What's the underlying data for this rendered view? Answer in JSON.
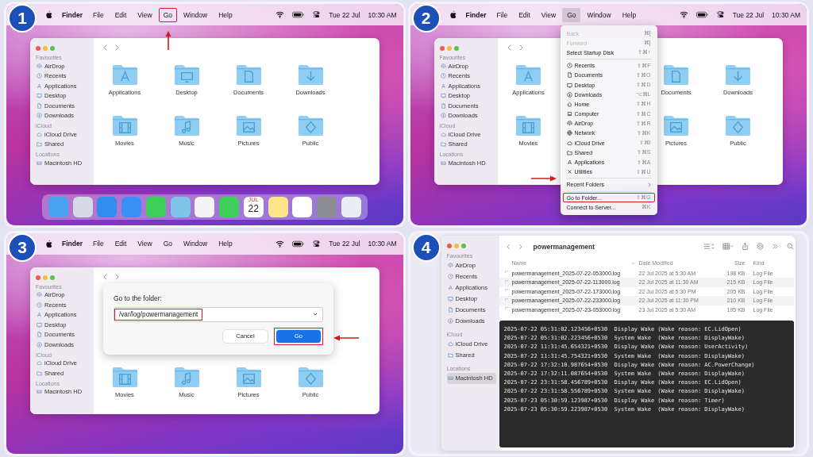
{
  "steps": [
    {
      "number": "1",
      "kind": "menu_bar",
      "pointer": {
        "kind": "up"
      },
      "menubar": {
        "app": "Finder",
        "menus": [
          {
            "label": "File",
            "selected": false,
            "highlighted": false
          },
          {
            "label": "Edit",
            "selected": false,
            "highlighted": false
          },
          {
            "label": "View",
            "selected": false,
            "highlighted": false
          },
          {
            "label": "Go",
            "selected": false,
            "highlighted": true
          },
          {
            "label": "Window",
            "selected": false,
            "highlighted": false
          },
          {
            "label": "Help",
            "selected": false,
            "highlighted": false
          }
        ],
        "date": "Tue 22 Jul",
        "time": "10:30 AM"
      },
      "finder": {
        "sidebar": [
          {
            "heading": "Favourites",
            "items": [
              {
                "label": "AirDrop",
                "selected": false
              },
              {
                "label": "Recents",
                "selected": false
              },
              {
                "label": "Applications",
                "selected": false
              },
              {
                "label": "Desktop",
                "selected": false
              },
              {
                "label": "Documents",
                "selected": false
              },
              {
                "label": "Downloads",
                "selected": false
              }
            ]
          },
          {
            "heading": "iCloud",
            "items": [
              {
                "label": "iCloud Drive",
                "selected": false
              },
              {
                "label": "Shared",
                "selected": false
              }
            ]
          },
          {
            "heading": "Locations",
            "items": [
              {
                "label": "Macintosh HD",
                "selected": false
              }
            ]
          }
        ],
        "folders": [
          {
            "label": "Applications"
          },
          {
            "label": "Desktop"
          },
          {
            "label": "Documents"
          },
          {
            "label": "Downloads"
          },
          {
            "label": "Movies"
          },
          {
            "label": "Music"
          },
          {
            "label": "Pictures"
          },
          {
            "label": "Public"
          }
        ]
      },
      "dock": {
        "calendar_month": "JUL",
        "calendar_day": "22"
      }
    },
    {
      "number": "2",
      "kind": "go_menu",
      "pointer": {
        "kind": "right"
      },
      "menubar": {
        "app": "Finder",
        "menus": [
          {
            "label": "File",
            "selected": false,
            "highlighted": false
          },
          {
            "label": "Edit",
            "selected": false,
            "highlighted": false
          },
          {
            "label": "View",
            "selected": false,
            "highlighted": false
          },
          {
            "label": "Go",
            "selected": true,
            "highlighted": false
          },
          {
            "label": "Window",
            "selected": false,
            "highlighted": false
          },
          {
            "label": "Help",
            "selected": false,
            "highlighted": false
          }
        ],
        "date": "Tue 22 Jul",
        "time": "10:30 AM"
      },
      "finder": {
        "sidebar": [
          {
            "heading": "Favourites",
            "items": [
              {
                "label": "AirDrop",
                "selected": false
              },
              {
                "label": "Recents",
                "selected": false
              },
              {
                "label": "Applications",
                "selected": false
              },
              {
                "label": "Desktop",
                "selected": false
              },
              {
                "label": "Documents",
                "selected": false
              },
              {
                "label": "Downloads",
                "selected": false
              }
            ]
          },
          {
            "heading": "iCloud",
            "items": [
              {
                "label": "iCloud Drive",
                "selected": false
              },
              {
                "label": "Shared",
                "selected": false
              }
            ]
          },
          {
            "heading": "Locations",
            "items": [
              {
                "label": "Macintosh HD",
                "selected": false
              }
            ]
          }
        ],
        "folders": [
          {
            "label": "Applications"
          },
          {
            "label": "Documents"
          },
          {
            "label": "Downloads"
          },
          {
            "label": "Movies"
          },
          {
            "label": "Pictures"
          },
          {
            "label": "Public"
          }
        ]
      },
      "menu": {
        "items": [
          {
            "kind": "item",
            "label": "Back",
            "shortcut": "⌘[",
            "disabled": true,
            "highlighted": false
          },
          {
            "kind": "item",
            "label": "Forward",
            "shortcut": "⌘]",
            "disabled": true,
            "highlighted": false
          },
          {
            "kind": "item",
            "label": "Select Startup Disk",
            "shortcut": "⇧⌘↑",
            "disabled": false,
            "highlighted": false
          },
          {
            "kind": "separator"
          },
          {
            "kind": "place",
            "label": "Recents",
            "shortcut": "⇧⌘F",
            "disabled": false,
            "highlighted": false
          },
          {
            "kind": "place",
            "label": "Documents",
            "shortcut": "⇧⌘O",
            "disabled": false,
            "highlighted": false
          },
          {
            "kind": "place",
            "label": "Desktop",
            "shortcut": "⇧⌘D",
            "disabled": false,
            "highlighted": false
          },
          {
            "kind": "place",
            "label": "Downloads",
            "shortcut": "⌥⌘L",
            "disabled": false,
            "highlighted": false
          },
          {
            "kind": "place",
            "label": "Home",
            "shortcut": "⇧⌘H",
            "disabled": false,
            "highlighted": false
          },
          {
            "kind": "place",
            "label": "Computer",
            "shortcut": "⇧⌘C",
            "disabled": false,
            "highlighted": false
          },
          {
            "kind": "place",
            "label": "AirDrop",
            "shortcut": "⇧⌘R",
            "disabled": false,
            "highlighted": false
          },
          {
            "kind": "place",
            "label": "Network",
            "shortcut": "⇧⌘K",
            "disabled": false,
            "highlighted": false
          },
          {
            "kind": "place",
            "label": "iCloud Drive",
            "shortcut": "⇧⌘I",
            "disabled": false,
            "highlighted": false
          },
          {
            "kind": "place",
            "label": "Shared",
            "shortcut": "⇧⌘S",
            "disabled": false,
            "highlighted": false
          },
          {
            "kind": "place",
            "label": "Applications",
            "shortcut": "⇧⌘A",
            "disabled": false,
            "highlighted": false
          },
          {
            "kind": "place",
            "label": "Utilities",
            "shortcut": "⇧⌘U",
            "disabled": false,
            "highlighted": false
          },
          {
            "kind": "separator"
          },
          {
            "kind": "submenu",
            "label": "Recent Folders",
            "disabled": false,
            "highlighted": false
          },
          {
            "kind": "separator"
          },
          {
            "kind": "item",
            "label": "Go to Folder...",
            "shortcut": "⇧⌘G",
            "disabled": false,
            "highlighted": true
          },
          {
            "kind": "item",
            "label": "Connect to Server...",
            "shortcut": "⌘K",
            "disabled": false,
            "highlighted": false
          }
        ]
      }
    },
    {
      "number": "3",
      "kind": "dialog",
      "pointer": {
        "kind": "left"
      },
      "menubar": {
        "app": "Finder",
        "menus": [
          {
            "label": "File",
            "selected": false,
            "highlighted": false
          },
          {
            "label": "Edit",
            "selected": false,
            "highlighted": false
          },
          {
            "label": "View",
            "selected": false,
            "highlighted": false
          },
          {
            "label": "Go",
            "selected": false,
            "highlighted": false
          },
          {
            "label": "Window",
            "selected": false,
            "highlighted": false
          },
          {
            "label": "Help",
            "selected": false,
            "highlighted": false
          }
        ],
        "date": "Tue 22 Jul",
        "time": "10:30 AM"
      },
      "finder": {
        "sidebar": [
          {
            "heading": "Favourites",
            "items": [
              {
                "label": "AirDrop",
                "selected": false
              },
              {
                "label": "Recents",
                "selected": false
              },
              {
                "label": "Applications",
                "selected": false
              },
              {
                "label": "Desktop",
                "selected": false
              },
              {
                "label": "Documents",
                "selected": false
              },
              {
                "label": "Downloads",
                "selected": false
              }
            ]
          },
          {
            "heading": "iCloud",
            "items": [
              {
                "label": "iCloud Drive",
                "selected": false
              },
              {
                "label": "Shared",
                "selected": false
              }
            ]
          },
          {
            "heading": "Locations",
            "items": [
              {
                "label": "Macintosh HD",
                "selected": false
              }
            ]
          }
        ],
        "folders": [
          {
            "label": "Movies"
          },
          {
            "label": "Music"
          },
          {
            "label": "Pictures"
          },
          {
            "label": "Public"
          }
        ]
      },
      "dialog": {
        "title": "Go to the folder:",
        "path": {
          "value": "/var/log/powermanagement",
          "highlighted": true
        },
        "buttons": [
          {
            "label": "Cancel",
            "default": false,
            "highlighted": false
          },
          {
            "label": "Go",
            "default": true,
            "highlighted": true
          }
        ]
      }
    },
    {
      "number": "4",
      "kind": "log_view",
      "finder": {
        "title": "powermanagement",
        "sidebar": [
          {
            "heading": "Favourites",
            "items": [
              {
                "label": "AirDrop",
                "selected": false
              },
              {
                "label": "Recents",
                "selected": false
              },
              {
                "label": "Applications",
                "selected": false
              },
              {
                "label": "Desktop",
                "selected": false
              },
              {
                "label": "Documents",
                "selected": false
              },
              {
                "label": "Downloads",
                "selected": false
              }
            ]
          },
          {
            "heading": "iCloud",
            "items": [
              {
                "label": "iCloud Drive",
                "selected": false
              },
              {
                "label": "Shared",
                "selected": false
              }
            ]
          },
          {
            "heading": "Locations",
            "items": [
              {
                "label": "Macintosh HD",
                "selected": true
              }
            ]
          }
        ],
        "columns": [
          "Name",
          "Date Modified",
          "Size",
          "Kind"
        ],
        "rows": [
          [
            "powermanagement_2025-07-22-053000.log",
            "22 Jul 2025 at 5:30 AM",
            "198 KB",
            "Log File"
          ],
          [
            "powermanagement_2025-07-22-113000.log",
            "22 Jul 2025 at 11:30 AM",
            "215 KB",
            "Log File"
          ],
          [
            "powermanagement_2025-07-22-173000.log",
            "22 Jul 2025 at 5:30 PM",
            "205 KB",
            "Log File"
          ],
          [
            "powermanagement_2025-07-22-233000.log",
            "22 Jul 2025 at 11:30 PM",
            "210 KB",
            "Log File"
          ],
          [
            "powermanagement_2025-07-23-053000.log",
            "23 Jul 2025 at 5:30 AM",
            "195 KB",
            "Log File"
          ]
        ],
        "log": [
          "2025-07-22 05:31:02.123456+0530  Display Wake (Wake reason: EC.LidOpen)",
          "2025-07-22 05:31:02.223456+0530  System Wake  (Wake reason: DisplayWake)",
          "2025-07-22 11:31:45.654321+0530  Display Wake (Wake reason: UserActivity)",
          "2025-07-22 11:31:45.754321+0530  System Wake  (Wake reason: DisplayWake)",
          "2025-07-22 17:32:10.987654+0530  Display Wake (Wake reason: AC.PowerChange)",
          "2025-07-22 17:32:11.087654+0530  System Wake  (Wake reason: DisplayWake)",
          "2025-07-22 23:31:58.456789+0530  Display Wake (Wake reason: EC.LidOpen)",
          "2025-07-22 23:31:58.556789+0530  System Wake  (Wake reason: DisplayWake)",
          "2025-07-23 05:30:59.123987+0530  Display Wake (Wake reason: Timer)",
          "2025-07-23 05:30:59.223987+0530  System Wake  (Wake reason: DisplayWake)"
        ]
      }
    }
  ]
}
